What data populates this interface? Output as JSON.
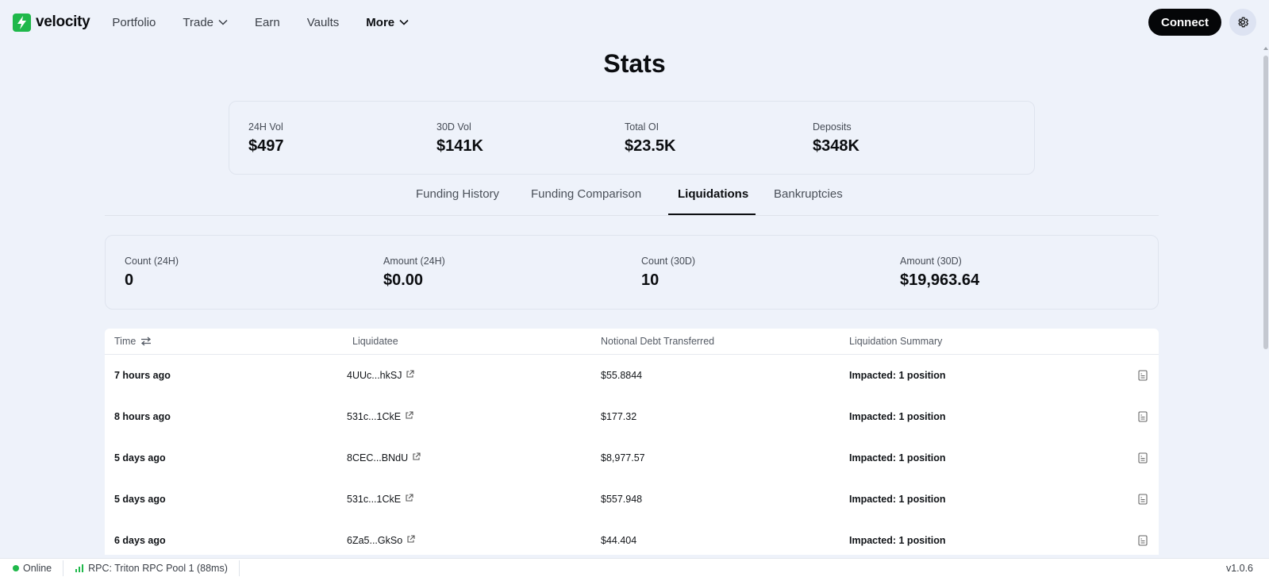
{
  "nav": {
    "logo_text": "velocity",
    "links": [
      {
        "label": "Portfolio"
      },
      {
        "label": "Trade"
      },
      {
        "label": "Earn"
      },
      {
        "label": "Vaults"
      },
      {
        "label": "More"
      }
    ],
    "connect_label": "Connect"
  },
  "page": {
    "title": "Stats"
  },
  "top_stats": [
    {
      "label": "24H Vol",
      "value": "$497"
    },
    {
      "label": "30D Vol",
      "value": "$141K"
    },
    {
      "label": "Total OI",
      "value": "$23.5K"
    },
    {
      "label": "Deposits",
      "value": "$348K"
    }
  ],
  "tabs": [
    {
      "label": "Funding History"
    },
    {
      "label": "Funding Comparison"
    },
    {
      "label": "Liquidations"
    },
    {
      "label": "Bankruptcies"
    }
  ],
  "active_tab": "Liquidations",
  "liq_stats": [
    {
      "label": "Count (24H)",
      "value": "0"
    },
    {
      "label": "Amount (24H)",
      "value": "$0.00"
    },
    {
      "label": "Count (30D)",
      "value": "10"
    },
    {
      "label": "Amount (30D)",
      "value": "$19,963.64"
    }
  ],
  "table": {
    "headers": [
      "Time",
      "Liquidatee",
      "Notional Debt Transferred",
      "Liquidation Summary"
    ],
    "rows": [
      {
        "time": "7 hours ago",
        "liquidatee": "4UUc...hkSJ",
        "debt": "$55.8844",
        "summary": "Impacted: 1 position"
      },
      {
        "time": "8 hours ago",
        "liquidatee": "531c...1CkE",
        "debt": "$177.32",
        "summary": "Impacted: 1 position"
      },
      {
        "time": "5 days ago",
        "liquidatee": "8CEC...BNdU",
        "debt": "$8,977.57",
        "summary": "Impacted: 1 position"
      },
      {
        "time": "5 days ago",
        "liquidatee": "531c...1CkE",
        "debt": "$557.948",
        "summary": "Impacted: 1 position"
      },
      {
        "time": "6 days ago",
        "liquidatee": "6Za5...GkSo",
        "debt": "$44.404",
        "summary": "Impacted: 1 position"
      }
    ]
  },
  "footer": {
    "status": "Online",
    "rpc": "RPC: Triton RPC Pool 1 (88ms)",
    "version": "v1.0.6"
  },
  "colors": {
    "brand": "#1fb84a",
    "background": "#eef2fa",
    "primary_button": "#050608"
  }
}
